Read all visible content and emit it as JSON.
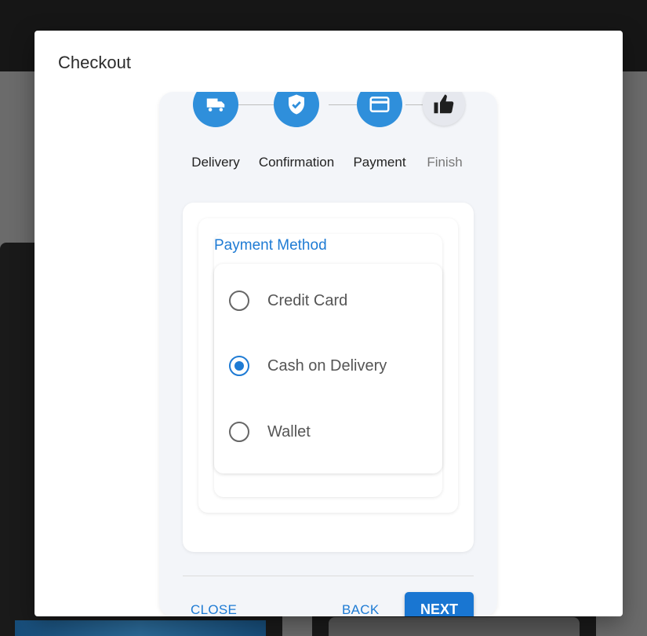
{
  "modal": {
    "title": "Checkout"
  },
  "stepper": {
    "steps": [
      {
        "label": "Delivery",
        "icon": "truck-icon",
        "state": "completed"
      },
      {
        "label": "Confirmation",
        "icon": "shield-check-icon",
        "state": "completed"
      },
      {
        "label": "Payment",
        "icon": "credit-card-icon",
        "state": "active"
      },
      {
        "label": "Finish",
        "icon": "thumbs-up-icon",
        "state": "inactive"
      }
    ]
  },
  "payment": {
    "section_title": "Payment Method",
    "options": [
      {
        "label": "Credit Card",
        "selected": false
      },
      {
        "label": "Cash on Delivery",
        "selected": true
      },
      {
        "label": "Wallet",
        "selected": false
      }
    ]
  },
  "footer": {
    "close_label": "CLOSE",
    "back_label": "BACK",
    "next_label": "NEXT"
  },
  "colors": {
    "accent": "#1976d2",
    "step_active": "#2f8fdb",
    "link": "#1e7bd4"
  }
}
